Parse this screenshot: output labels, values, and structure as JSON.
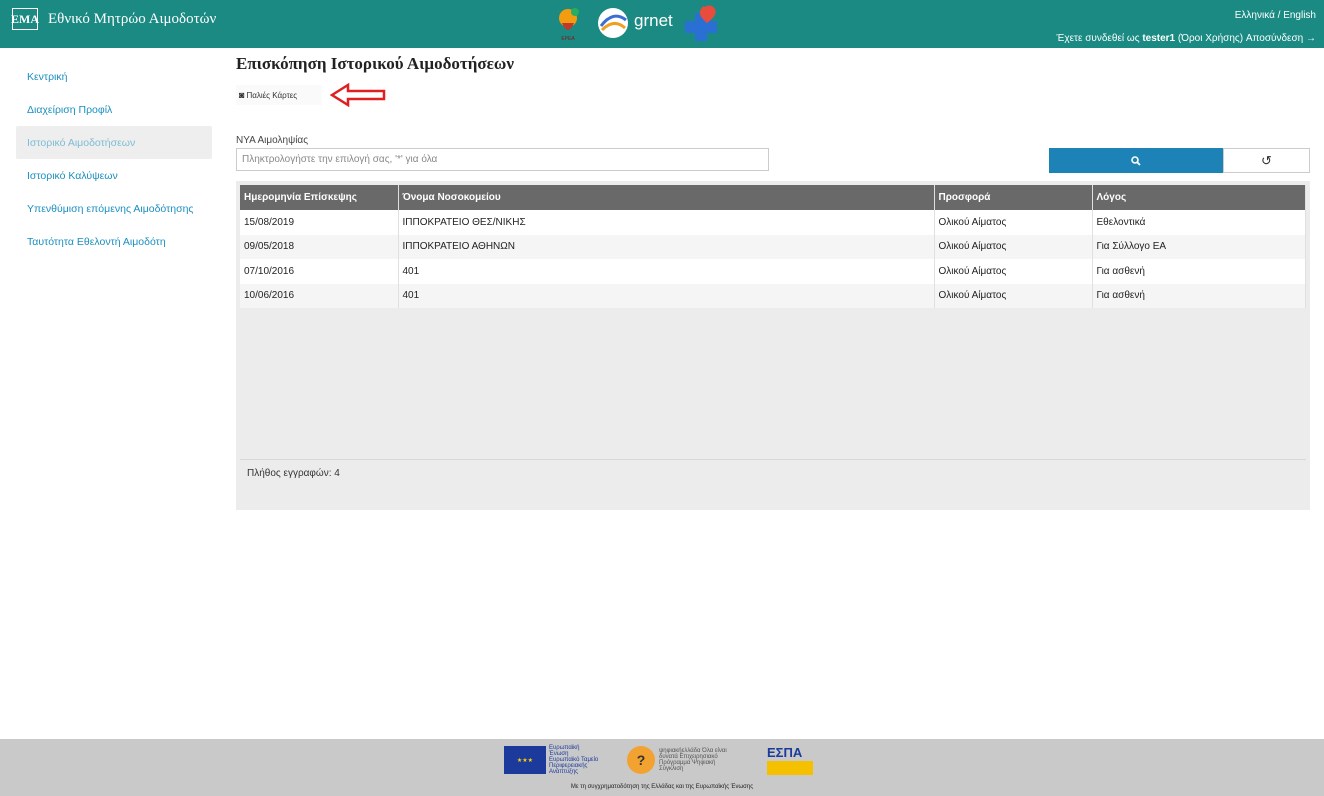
{
  "header": {
    "logo_text": "EMA",
    "title": "Εθνικό Μητρώο Αιμοδοτών",
    "center_logos": {
      "eoea": "ΕΡΕΑ",
      "grnet": "grnet"
    },
    "language_link": "Ελληνικά / English",
    "logged_in_prefix": "Έχετε συνδεθεί ως",
    "username": "tester1",
    "terms_link": "(Όροι Χρήσης)",
    "logout_link": "Αποσύνδεση"
  },
  "sidebar": {
    "items": [
      {
        "label": "Κεντρική",
        "active": false
      },
      {
        "label": "Διαχείριση Προφίλ",
        "active": false
      },
      {
        "label": "Ιστορικό Αιμοδοτήσεων",
        "active": true
      },
      {
        "label": "Ιστορικό Καλύψεων",
        "active": false
      },
      {
        "label": "Υπενθύμιση επόμενης Αιμοδότησης",
        "active": false
      },
      {
        "label": "Ταυτότητα Εθελοντή Αιμοδότη",
        "active": false
      }
    ]
  },
  "main": {
    "page_title": "Επισκόπηση Ιστορικού Αιμοδοτήσεων",
    "old_cards_button": "Παλιές Κάρτες",
    "nya_label": "ΝΥΑ Αιμοληψίας",
    "search_placeholder": "Πληκτρολογήστε την επιλογή σας, '*' για όλα",
    "table": {
      "headers": [
        "Ημερομηνία Επίσκεψης",
        "Όνομα Νοσοκομείου",
        "Προσφορά",
        "Λόγος"
      ],
      "rows": [
        [
          "15/08/2019",
          "ΙΠΠΟΚΡΑΤΕΙΟ ΘΕΣ/ΝΙΚΗΣ",
          "Ολικού Αίματος",
          "Εθελοντικά"
        ],
        [
          "09/05/2018",
          "ΙΠΠΟΚΡΑΤΕΙΟ ΑΘΗΝΩΝ",
          "Ολικού Αίματος",
          "Για Σύλλογο ΕΑ"
        ],
        [
          "07/10/2016",
          "401",
          "Ολικού Αίματος",
          "Για ασθενή"
        ],
        [
          "10/06/2016",
          "401",
          "Ολικού Αίματος",
          "Για ασθενή"
        ]
      ]
    },
    "record_count": "Πλήθος εγγραφών: 4"
  },
  "footer": {
    "eu_text": "Ευρωπαϊκή Ένωση Ευρωπαϊκό Ταμείο Περιφερειακής Ανάπτυξης",
    "digital_text": "ψηφιακήελλάδα Όλα είναι δυνατά Επιχειρησιακό Πρόγραμμα Ψηφιακή Σύγκλιση",
    "espa_text": "ΕΣΠΑ",
    "caption": "Με τη συγχρηματοδότηση της Ελλάδας και της Ευρωπαϊκής Ένωσης"
  },
  "colors": {
    "header_bg": "#1a8a83",
    "link": "#1a8fc0",
    "search_button": "#1d82b5",
    "table_header": "#696969",
    "arrow": "#e02020"
  }
}
